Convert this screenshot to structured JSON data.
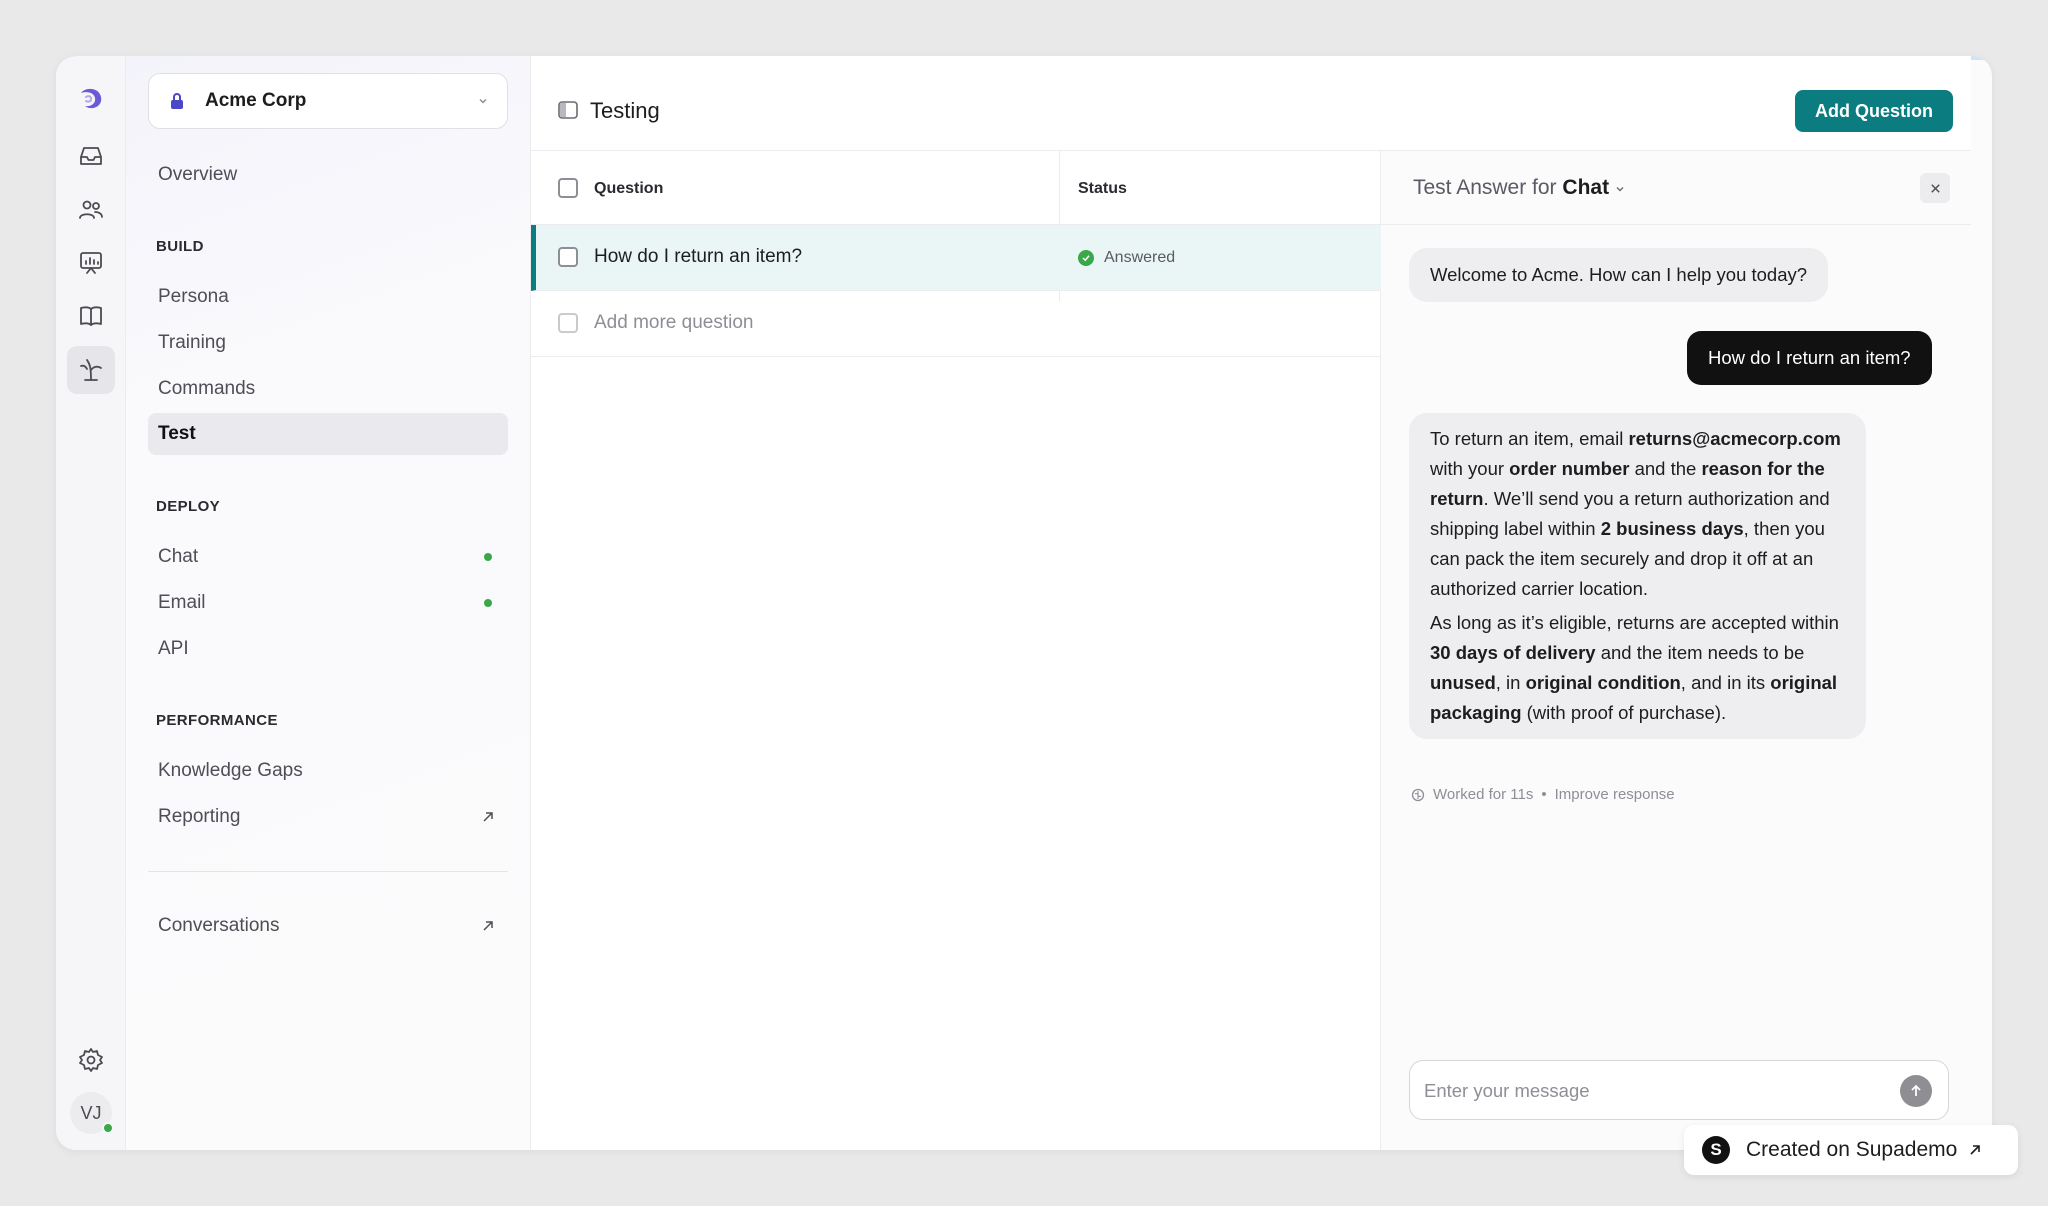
{
  "nav": {
    "org_name": "Acme Corp",
    "overview": "Overview",
    "build_header": "BUILD",
    "build_items": [
      "Persona",
      "Training",
      "Commands",
      "Test"
    ],
    "deploy_header": "DEPLOY",
    "deploy_items": [
      "Chat",
      "Email",
      "API"
    ],
    "performance_header": "PERFORMANCE",
    "performance_items": [
      "Knowledge Gaps",
      "Reporting"
    ],
    "conversations": "Conversations",
    "active_item": "Test"
  },
  "user": {
    "initials": "VJ"
  },
  "main": {
    "title": "Testing",
    "add_button": "Add Question",
    "columns": [
      "Question",
      "Status"
    ],
    "rows": [
      {
        "question": "How do I return an item?",
        "status": "Answered"
      }
    ],
    "add_more_placeholder": "Add more question"
  },
  "chat": {
    "title_prefix": "Test Answer for",
    "channel": "Chat",
    "welcome": "Welcome to Acme. How can I help you today?",
    "user_message": "How do I return an item?",
    "answer_p1": {
      "t1": "To return an item, email ",
      "b1": "returns@acmecorp.com",
      "t2": " with your ",
      "b2": "order number",
      "t3": " and the ",
      "b3": "reason for the return",
      "t4": ". We’ll send you a return authorization and shipping label within ",
      "b4": "2 business days",
      "t5": ", then you can pack the item securely and drop it off at an authorized carrier location."
    },
    "answer_p2": {
      "t1": "As long as it’s eligible, returns are accepted within ",
      "b1": "30 days of delivery",
      "t2": " and the item needs to be ",
      "b2": "unused",
      "t3": ", in ",
      "b3": "original condition",
      "t4": ", and in its ",
      "b4": "original packaging",
      "t5": " (with proof of purchase)."
    },
    "worked_for": "Worked for 11s",
    "meta_sep": "•",
    "improve": "Improve response",
    "input_placeholder": "Enter your message"
  },
  "badge": {
    "text": "Created on Supademo",
    "logo_letter": "S"
  },
  "colors": {
    "accent": "#0b7d80",
    "status_green": "#3aa84a",
    "selected_row": "#eaf6f5"
  }
}
